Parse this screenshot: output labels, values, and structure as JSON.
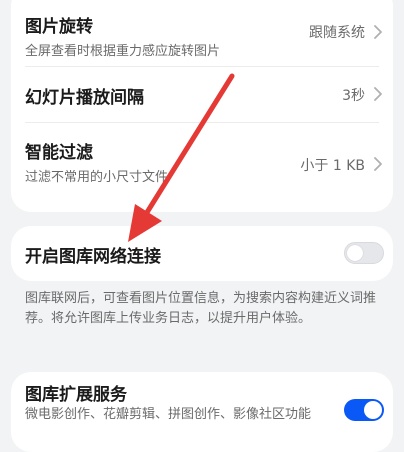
{
  "settings_card": {
    "rows": [
      {
        "title": "图片旋转",
        "subtitle": "全屏查看时根据重力感应旋转图片",
        "value": "跟随系统"
      },
      {
        "title": "幻灯片播放间隔",
        "value": "3秒"
      },
      {
        "title": "智能过滤",
        "subtitle": "过滤不常用的小尺寸文件",
        "value": "小于 1 KB"
      }
    ]
  },
  "network": {
    "title": "开启图库网络连接",
    "toggle_on": false,
    "description": "图库联网后，可查看图片位置信息，为搜索内容构建近义词推荐。将允许图库上传业务日志，以提升用户体验。"
  },
  "extension": {
    "title": "图库扩展服务",
    "subtitle": "微电影创作、花瓣剪辑、拼图创作、影像社区功能",
    "toggle_on": true
  },
  "colors": {
    "accent": "#0a59f7",
    "annotation_arrow": "#e53935"
  },
  "icons": [
    "chevron-right-icon",
    "annotation-arrow"
  ]
}
